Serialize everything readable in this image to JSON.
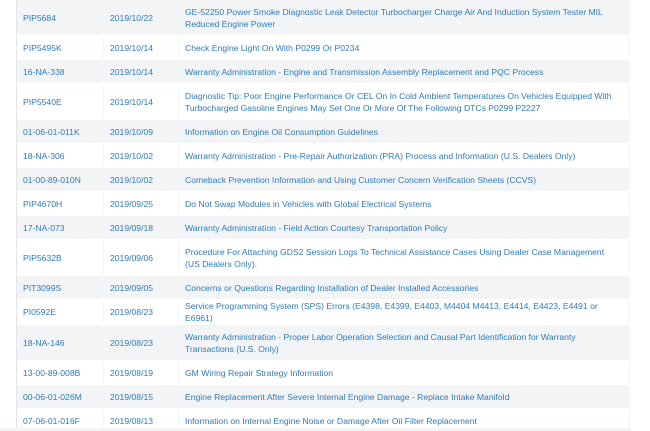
{
  "bulletins": [
    {
      "number": "PIP5684",
      "date": "2019/10/22",
      "title": "GE-52250 Power Smoke Diagnostic Leak Detector Turbocharger Charge Air And Induction System Tester MIL Reduced Engine Power"
    },
    {
      "number": "PIP5495K",
      "date": "2019/10/14",
      "title": "Check Engine Light On With P0299 Or P0234"
    },
    {
      "number": "16-NA-338",
      "date": "2019/10/14",
      "title": "Warranty Administration - Engine and Transmission Assembly Replacement and PQC Process"
    },
    {
      "number": "PIP5540E",
      "date": "2019/10/14",
      "title": "Diagnostic Tip: Poor Engine Performance Or CEL On In Cold Ambient Temperatures On Vehicles Equipped With Turbocharged Gasoline Engines May Set One Or More Of The Following DTCs P0299 P2227"
    },
    {
      "number": "01-06-01-011K",
      "date": "2019/10/09",
      "title": "Information on Engine Oil Consumption Guidelines"
    },
    {
      "number": "18-NA-306",
      "date": "2019/10/02",
      "title": "Warranty Administration - Pre-Repair Authorization (PRA) Process and Information (U.S. Dealers Only)"
    },
    {
      "number": "01-00-89-010N",
      "date": "2019/10/02",
      "title": "Comeback Prevention Information and Using Customer Concern Verification Sheets (CCVS)"
    },
    {
      "number": "PIP4670H",
      "date": "2019/09/25",
      "title": "Do Not Swap Modules in Vehicles with Global Electrical Systems"
    },
    {
      "number": "17-NA-073",
      "date": "2019/09/18",
      "title": "Warranty Administration - Field Action Courtesy Transportation Policy"
    },
    {
      "number": "PIP5632B",
      "date": "2019/09/06",
      "title": "Procedure For Attaching GDS2 Session Logs To Technical Assistance Cases Using Dealer Case Management (US Dealers Only)."
    },
    {
      "number": "PIT3099S",
      "date": "2019/09/05",
      "title": "Concerns or Questions Regarding Installation of Dealer Installed Accessories"
    },
    {
      "number": "PI0592E",
      "date": "2019/08/23",
      "title": "Service Programming System (SPS) Errors (E4398, E4399, E4403, M4404 M4413, E4414, E4423, E4491 or E6961)"
    },
    {
      "number": "18-NA-146",
      "date": "2019/08/23",
      "title": "Warranty Administration - Proper Labor Operation Selection and Causal Part Identification for Warranty Transactions (U.S. Only)"
    },
    {
      "number": "13-00-89-008B",
      "date": "2019/08/19",
      "title": "GM Wiring Repair Strategy Information"
    },
    {
      "number": "00-06-01-026M",
      "date": "2019/08/15",
      "title": "Engine Replacement After Severe Internal Engine Damage - Replace Intake Manifold"
    },
    {
      "number": "07-06-01-016F",
      "date": "2019/08/13",
      "title": "Information on Internal Engine Noise or Damage After Oil Filter Replacement"
    }
  ],
  "colors": {
    "link": "#2d7bbd",
    "row_alt": "#f3f4f6",
    "row": "#ffffff"
  }
}
